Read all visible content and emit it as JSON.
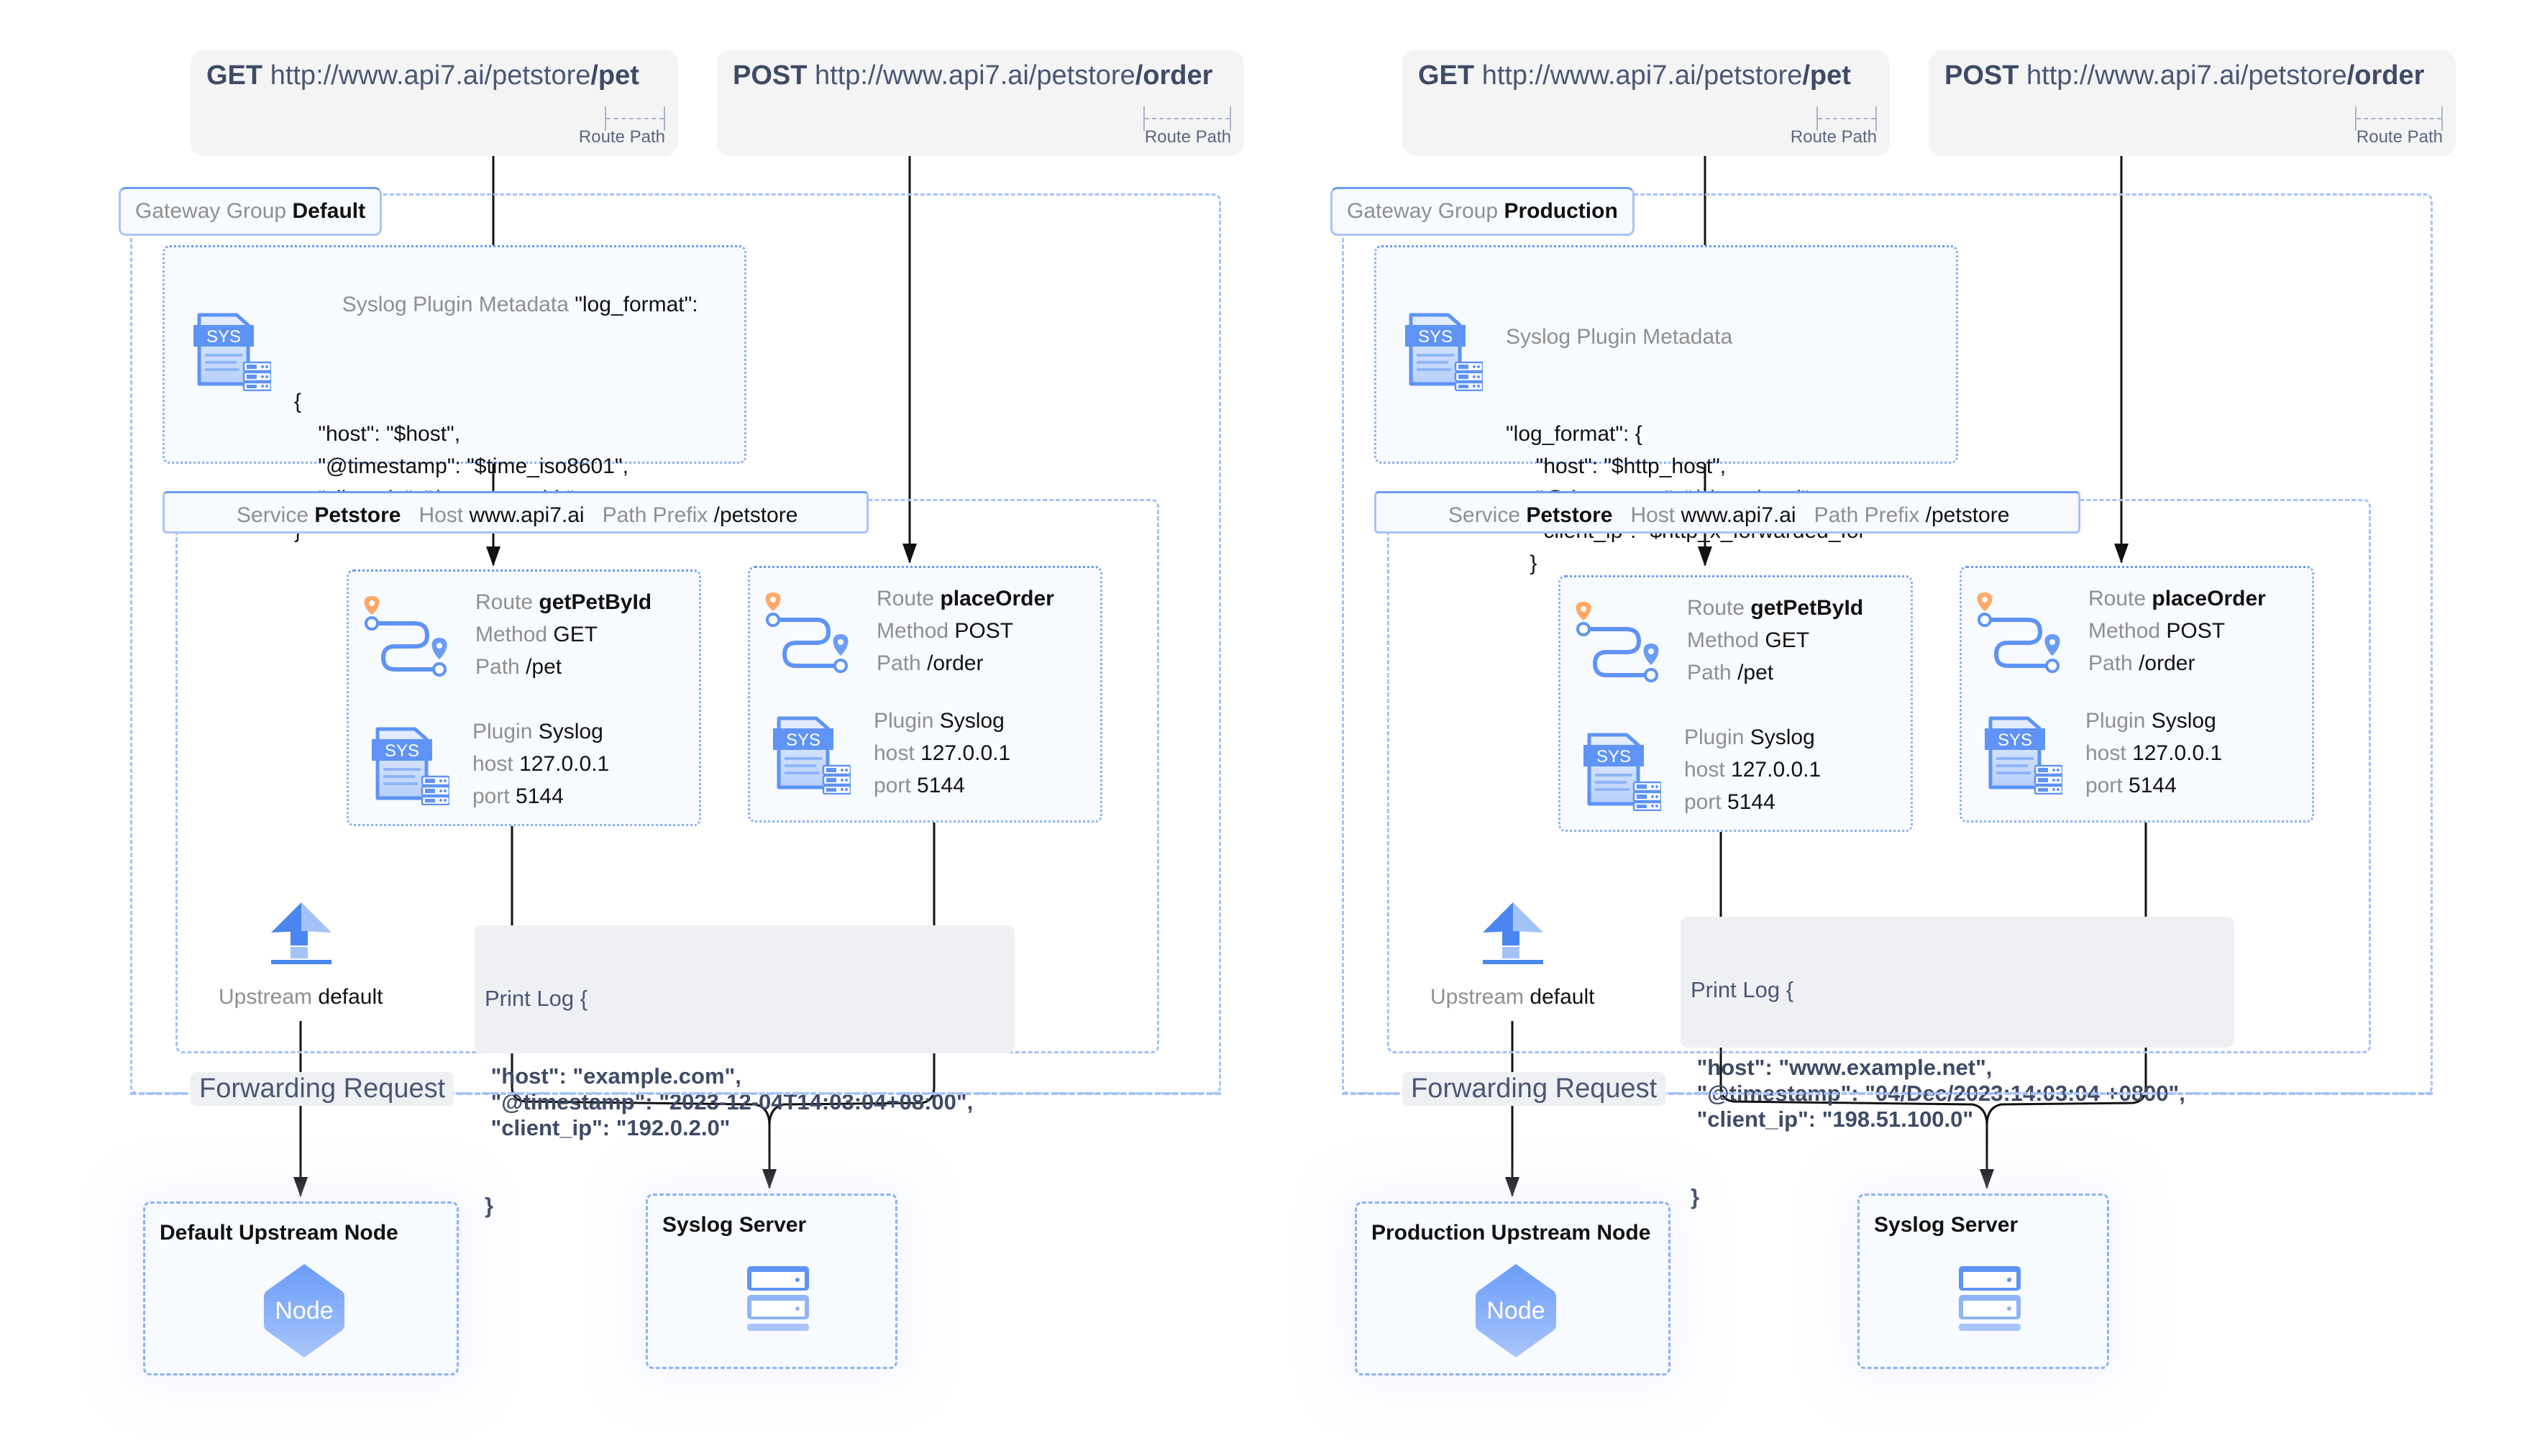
{
  "panels": [
    {
      "id": "default",
      "requests": [
        {
          "method": "GET",
          "base_url": "http://www.api7.ai/petstore",
          "path": "/pet",
          "annotation": "Route Path"
        },
        {
          "method": "POST",
          "base_url": "http://www.api7.ai/petstore",
          "path": "/order",
          "annotation": "Route Path"
        }
      ],
      "gateway_group": {
        "label": "Gateway Group",
        "name": "Default"
      },
      "plugin_metadata": {
        "title": "Syslog Plugin Metadata",
        "lines": [
          "\"log_format\":",
          "{",
          "    \"host\": \"$host\",",
          "    \"@timestamp\": \"$time_iso8601\",",
          "    \"client_ip\": \"$remote_addr\"",
          "}"
        ]
      },
      "service": {
        "label": "Service",
        "name": "Petstore",
        "host_label": "Host",
        "host": "www.api7.ai",
        "prefix_label": "Path Prefix",
        "prefix": "/petstore"
      },
      "routes": [
        {
          "route_label": "Route",
          "name": "getPetById",
          "method_label": "Method",
          "method": "GET",
          "path_label": "Path",
          "path": "/pet",
          "plugin_label": "Plugin",
          "plugin": "Syslog",
          "host_label": "host",
          "host": "127.0.0.1",
          "port_label": "port",
          "port": "5144"
        },
        {
          "route_label": "Route",
          "name": "placeOrder",
          "method_label": "Method",
          "method": "POST",
          "path_label": "Path",
          "path": "/order",
          "plugin_label": "Plugin",
          "plugin": "Syslog",
          "host_label": "host",
          "host": "127.0.0.1",
          "port_label": "port",
          "port": "5144"
        }
      ],
      "upstream": {
        "label": "Upstream",
        "name": "default"
      },
      "print_log": {
        "title": "Print Log {",
        "lines": [
          " \"host\": \"example.com\",",
          " \"@timestamp\": \"2023-12-04T14:03:04+08:00\",",
          " \"client_ip\": \"192.0.2.0\""
        ],
        "close": "}"
      },
      "forwarding_label": "Forwarding Request",
      "upstream_node": {
        "title": "Default Upstream Node",
        "node_label": "Node"
      },
      "syslog_server": {
        "title": "Syslog Server"
      }
    },
    {
      "id": "production",
      "requests": [
        {
          "method": "GET",
          "base_url": "http://www.api7.ai/petstore",
          "path": "/pet",
          "annotation": "Route Path"
        },
        {
          "method": "POST",
          "base_url": "http://www.api7.ai/petstore",
          "path": "/order",
          "annotation": "Route Path"
        }
      ],
      "gateway_group": {
        "label": "Gateway Group",
        "name": "Production"
      },
      "plugin_metadata": {
        "title": "Syslog Plugin Metadata",
        "lines": [
          "\"log_format\": {",
          "     \"host\": \"$http_host\",",
          "     \"@timestamp\": \"$time_local\",",
          "     \"client_ip\": \"$http_x_forwarded_for\"",
          "    }"
        ]
      },
      "service": {
        "label": "Service",
        "name": "Petstore",
        "host_label": "Host",
        "host": "www.api7.ai",
        "prefix_label": "Path Prefix",
        "prefix": "/petstore"
      },
      "routes": [
        {
          "route_label": "Route",
          "name": "getPetById",
          "method_label": "Method",
          "method": "GET",
          "path_label": "Path",
          "path": "/pet",
          "plugin_label": "Plugin",
          "plugin": "Syslog",
          "host_label": "host",
          "host": "127.0.0.1",
          "port_label": "port",
          "port": "5144"
        },
        {
          "route_label": "Route",
          "name": "placeOrder",
          "method_label": "Method",
          "method": "POST",
          "path_label": "Path",
          "path": "/order",
          "plugin_label": "Plugin",
          "plugin": "Syslog",
          "host_label": "host",
          "host": "127.0.0.1",
          "port_label": "port",
          "port": "5144"
        }
      ],
      "upstream": {
        "label": "Upstream",
        "name": "default"
      },
      "print_log": {
        "title": "Print Log {",
        "lines": [
          " \"host\": \"www.example.net\",",
          " \"@timestamp\": \"04/Dec/2023:14:03:04 +0800\",",
          " \"client_ip\": \"198.51.100.0\""
        ],
        "close": "}"
      },
      "forwarding_label": "Forwarding Request",
      "upstream_node": {
        "title": "Production Upstream Node",
        "node_label": "Node"
      },
      "syslog_server": {
        "title": "Syslog Server"
      }
    }
  ],
  "icons": {
    "sys_badge": "SYS",
    "route": "route-path-icon",
    "upstream": "upstream-arrow-icon",
    "node": "node-hexagon-icon",
    "server": "server-icon"
  },
  "colors": {
    "accent": "#5f93f5",
    "accent_light": "#a7c2f7",
    "pin_orange": "#ffa868",
    "text_slate": "#4a5774"
  }
}
